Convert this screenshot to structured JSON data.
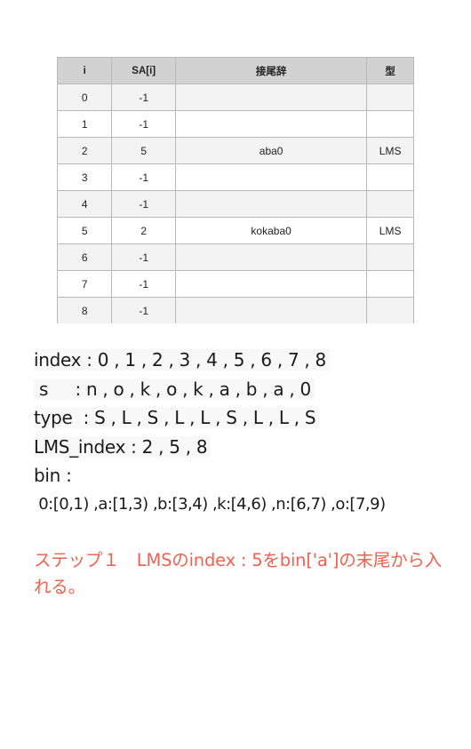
{
  "table": {
    "headers": [
      "i",
      "SA[i]",
      "接尾辞",
      "型"
    ],
    "rows": [
      {
        "i": "0",
        "sa": "-1",
        "suffix": "",
        "type": ""
      },
      {
        "i": "1",
        "sa": "-1",
        "suffix": "",
        "type": ""
      },
      {
        "i": "2",
        "sa": "5",
        "suffix": "aba0",
        "type": "LMS"
      },
      {
        "i": "3",
        "sa": "-1",
        "suffix": "",
        "type": ""
      },
      {
        "i": "4",
        "sa": "-1",
        "suffix": "",
        "type": ""
      },
      {
        "i": "5",
        "sa": "2",
        "suffix": "kokaba0",
        "type": "LMS"
      },
      {
        "i": "6",
        "sa": "-1",
        "suffix": "",
        "type": ""
      },
      {
        "i": "7",
        "sa": "-1",
        "suffix": "",
        "type": ""
      },
      {
        "i": "8",
        "sa": "-1",
        "suffix": "",
        "type": ""
      }
    ]
  },
  "info": {
    "index_line": "index : 0 , 1 , 2 , 3 , 4 , 5 , 6 , 7 , 8",
    "s_line": " s     : n , o , k , o , k , a , b , a , 0",
    "type_line": "type  : S , L , S , L , L , S , L , L , S",
    "lms_line": "LMS_index : 2 , 5 , 8",
    "bin_label": "bin :",
    "bin_values": " 0:[0,1) ,a:[1,3) ,b:[3,4) ,k:[4,6) ,n:[6,7) ,o:[7,9)"
  },
  "step": {
    "text": "ステップ１　LMSのindex : 5をbin['a']の末尾から入れる。",
    "color": "#f0614f"
  }
}
